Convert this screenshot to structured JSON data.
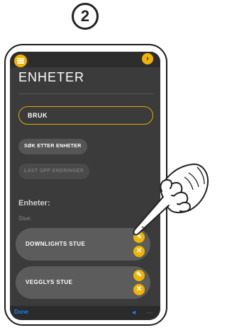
{
  "step_number": "2",
  "header": {
    "title": "ENHETER",
    "menu_icon": "hamburger-icon",
    "next_icon": "chevron-right-icon",
    "next_glyph": "›"
  },
  "mode_button": {
    "label": "BRUK"
  },
  "actions": {
    "search_label": "SØK ETTER ENHETER",
    "upload_label": "LAST OPP ENDRINGER"
  },
  "devices_section": {
    "heading": "Enheter:",
    "group_label": "Stue:",
    "items": [
      {
        "label": "DOWNLIGHTS STUE",
        "edit_icon": "pencil-icon",
        "delete_icon": "close-icon"
      },
      {
        "label": "VEGGLYS STUE",
        "edit_icon": "pencil-icon",
        "delete_icon": "close-icon"
      }
    ]
  },
  "bottom_bar": {
    "done_label": "Done",
    "arrow_glyph": "◄",
    "arrow2_glyph": "—"
  },
  "glyphs": {
    "pencil": "✎",
    "close": "✕"
  },
  "colors": {
    "accent": "#f0b400",
    "screen_bg": "#3b3b3b",
    "link": "#1e7df0"
  }
}
